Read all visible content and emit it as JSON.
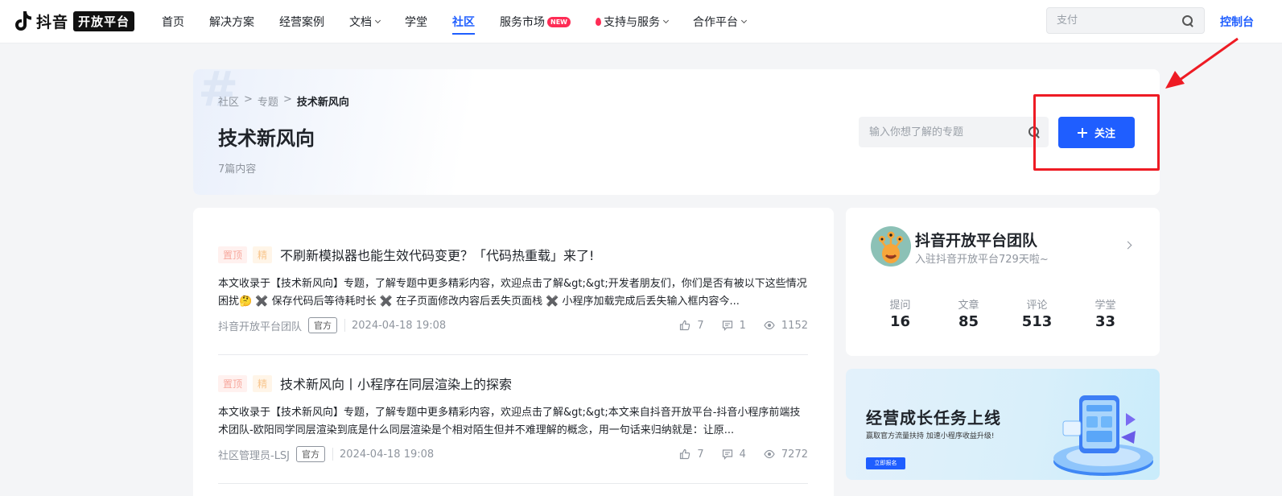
{
  "nav": {
    "brand": "抖音",
    "brand_badge": "开放平台",
    "items": [
      {
        "label": "首页"
      },
      {
        "label": "解决方案"
      },
      {
        "label": "经营案例"
      },
      {
        "label": "文档"
      },
      {
        "label": "学堂"
      },
      {
        "label": "社区"
      },
      {
        "label": "服务市场"
      },
      {
        "label": "支持与服务"
      },
      {
        "label": "合作平台"
      }
    ],
    "new_badge": "NEW",
    "search_placeholder": "支付",
    "console": "控制台",
    "active_color": "#1f5eff"
  },
  "topic": {
    "breadcrumb": [
      "社区",
      ">",
      "专题",
      ">",
      "技术新风向"
    ],
    "title": "技术新风向",
    "count": "7篇内容",
    "search_placeholder": "输入你想了解的专题",
    "follow_label": "关注"
  },
  "articles": [
    {
      "tag_top": "置顶",
      "tag_good": "精",
      "title": "不刷新模拟器也能生效代码变更？「代码热重载」来了!",
      "desc": "本文收录于【技术新风向】专题，了解专题中更多精彩内容，欢迎点击了解&gt;&gt;开发者朋友们，你们是否有被以下这些情况困扰🤔 ✖️ 保存代码后等待耗时长 ✖️ 在子页面修改内容后丢失页面栈 ✖️ 小程序加载完成后丢失输入框内容今...",
      "author": "抖音开放平台团队",
      "official": "官方",
      "date": "2024-04-18 19:08",
      "likes": "7",
      "comments": "1",
      "views": "1152"
    },
    {
      "tag_top": "置顶",
      "tag_good": "精",
      "title": "技术新风向丨小程序在同层渲染上的探索",
      "desc": "本文收录于【技术新风向】专题，了解专题中更多精彩内容，欢迎点击了解&gt;&gt;本文来自抖音开放平台-抖音小程序前端技术团队-欧阳同学同层渲染到底是什么同层渲染是个相对陌生但并不难理解的概念，用一句话来归纳就是：让原...",
      "author": "社区管理员-LSJ",
      "official": "官方",
      "date": "2024-04-18 19:08",
      "likes": "7",
      "comments": "4",
      "views": "7272"
    }
  ],
  "team": {
    "name": "抖音开放平台团队",
    "subtitle": "入驻抖音开放平台729天啦~",
    "stats": [
      {
        "label": "提问",
        "value": "16"
      },
      {
        "label": "文章",
        "value": "85"
      },
      {
        "label": "评论",
        "value": "513"
      },
      {
        "label": "学堂",
        "value": "33"
      }
    ]
  },
  "banner": {
    "title": "经营成长任务上线",
    "subtitle": "赢取官方流量扶持 加速小程序收益升级!",
    "button": "立即报名"
  },
  "colors": {
    "accent": "#1f5eff",
    "annotation_red": "#ee1b24"
  }
}
